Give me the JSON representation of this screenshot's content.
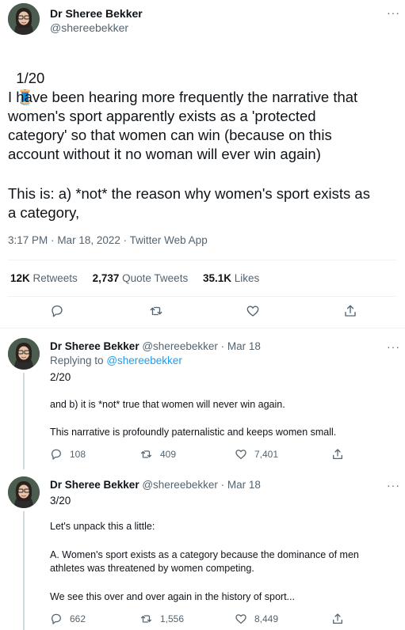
{
  "main_tweet": {
    "author_name": "Dr Sheree Bekker",
    "author_handle": "@shereebekker",
    "number": "1/20",
    "number_emoji": "🧵",
    "paragraph1": "I have been hearing more frequently the narrative that\nwomen's sport apparently exists as a 'protected\ncategory' so that women can win (because on this\naccount without it no woman will ever win again)",
    "paragraph2": "This is: a) *not* the reason why women's sport exists as\na category,",
    "time": "3:17 PM",
    "date": "Mar 18, 2022",
    "source": "Twitter Web App",
    "stats": {
      "retweets_count": "12K",
      "retweets_label": "Retweets",
      "quotes_count": "2,737",
      "quotes_label": "Quote Tweets",
      "likes_count": "35.1K",
      "likes_label": "Likes"
    },
    "actions": [
      "reply-icon",
      "retweet-icon",
      "like-icon",
      "share-icon"
    ]
  },
  "replies": [
    {
      "author_name": "Dr Sheree Bekker",
      "author_handle": "@shereebekker",
      "date": "Mar 18",
      "replying_prefix": "Replying to",
      "replying_to": "@shereebekker",
      "number": "2/20",
      "line1": "and b) it is *not* true that women will never win again.",
      "line2": "This narrative is profoundly paternalistic and keeps women small.",
      "reply_count": "108",
      "retweet_count": "409",
      "like_count": "7,401"
    },
    {
      "author_name": "Dr Sheree Bekker",
      "author_handle": "@shereebekker",
      "date": "Mar 18",
      "number": "3/20",
      "line1": "Let's unpack this a little:",
      "line2": "A. Women's sport exists as a category because the dominance of men\nathletes was threatened by women competing.",
      "line3": "We see this over and over again in the history of sport...",
      "reply_count": "662",
      "retweet_count": "1,556",
      "like_count": "8,449"
    }
  ],
  "more_label": "···",
  "separator": "·",
  "colors": {
    "text": "#0f1419",
    "muted": "#536471",
    "link": "#1d9bf0",
    "divider": "#eff3f4"
  }
}
